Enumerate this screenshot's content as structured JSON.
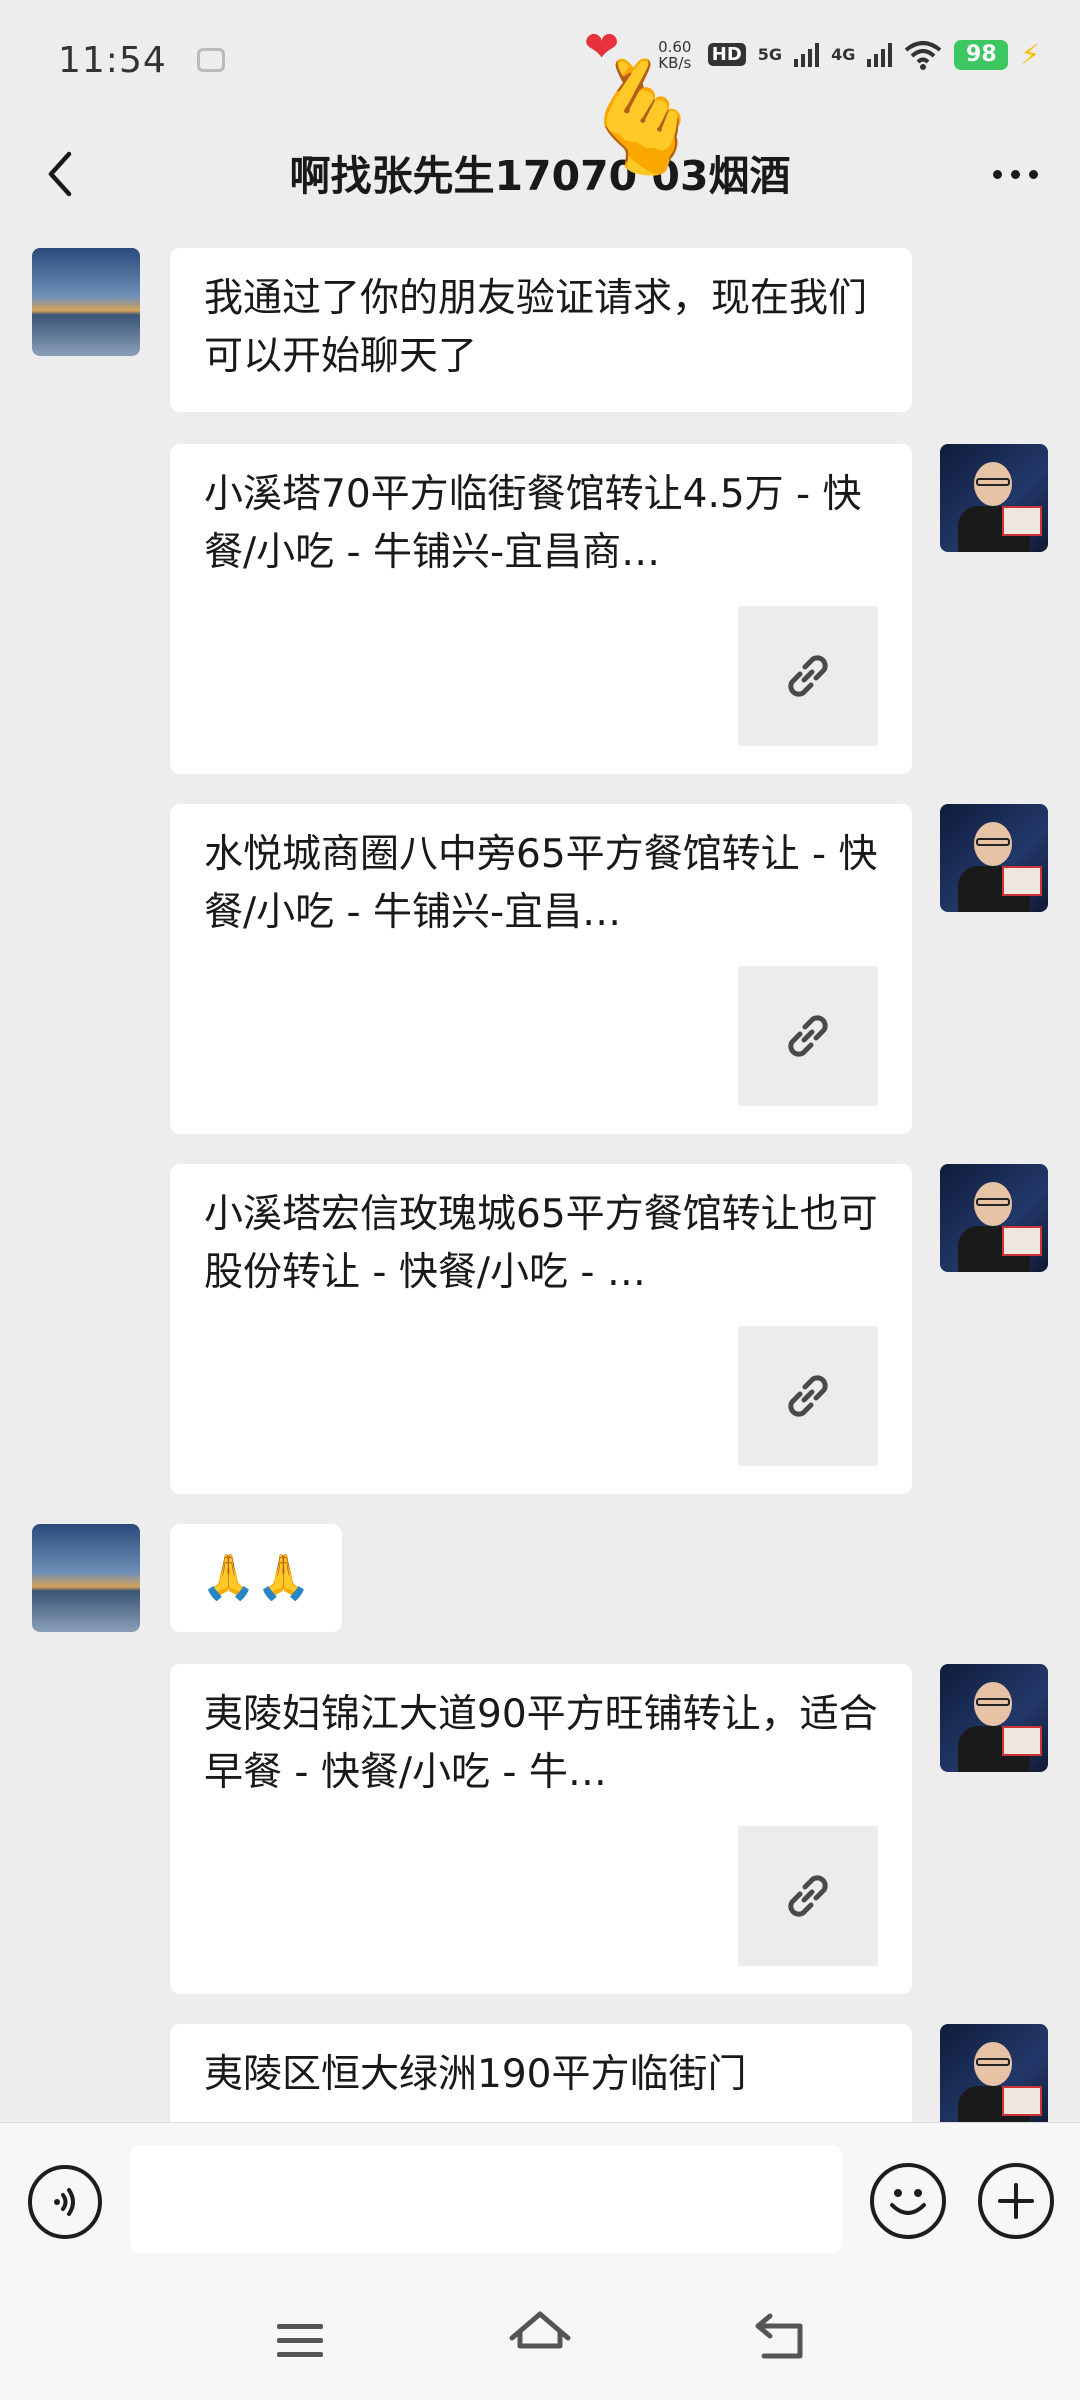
{
  "status_bar": {
    "time": "11:54",
    "net_speed_value": "0.60",
    "net_speed_unit": "KB/s",
    "hd_label": "HD",
    "network_1": "5G",
    "network_2": "4G",
    "battery": "98"
  },
  "header": {
    "title": "啊找张先生17070  03烟酒"
  },
  "messages": [
    {
      "side": "left",
      "avatar": "city-night-avatar",
      "text": "我通过了你的朋友验证请求，现在我们可以开始聊天了"
    },
    {
      "side": "right",
      "avatar": "man-with-glasses-avatar",
      "type": "link",
      "text": "小溪塔70平方临街餐馆转让4.5万 - 快餐/小吃 - 牛铺兴-宜昌商…"
    },
    {
      "side": "right",
      "avatar": "man-with-glasses-avatar",
      "type": "link",
      "text": "水悦城商圈八中旁65平方餐馆转让 - 快餐/小吃 - 牛铺兴-宜昌…"
    },
    {
      "side": "right",
      "avatar": "man-with-glasses-avatar",
      "type": "link",
      "text": "小溪塔宏信玫瑰城65平方餐馆转让也可股份转让 - 快餐/小吃 - …"
    },
    {
      "side": "left",
      "avatar": "city-night-avatar",
      "text": "🙏🙏"
    },
    {
      "side": "right",
      "avatar": "man-with-glasses-avatar",
      "type": "link",
      "text": "夷陵妇锦江大道90平方旺铺转让，适合早餐 - 快餐/小吃 - 牛…"
    },
    {
      "side": "right",
      "avatar": "man-with-glasses-avatar",
      "type": "link",
      "text": "夷陵区恒大绿洲190平方临街门"
    }
  ],
  "input": {
    "placeholder": ""
  },
  "icons": {
    "back": "chevron-left-icon",
    "more": "more-dots-icon",
    "link": "link-icon",
    "voice": "voice-icon",
    "emoji": "emoji-icon",
    "plus": "plus-icon"
  }
}
